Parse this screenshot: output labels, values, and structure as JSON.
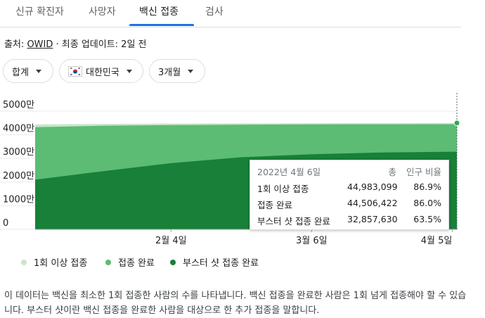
{
  "tabs": [
    {
      "label": "신규 확진자"
    },
    {
      "label": "사망자"
    },
    {
      "label": "백신 접종"
    },
    {
      "label": "검사"
    }
  ],
  "source": {
    "prefix": "출처: ",
    "link": "OWID",
    "suffix": " · 최종 업데이트: 2일 전"
  },
  "filters": [
    {
      "label": "합계"
    },
    {
      "label": "대한민국"
    },
    {
      "label": "3개월"
    }
  ],
  "chart_data": {
    "type": "area",
    "colors": {
      "one_dose": "#c8e6c9",
      "full": "#5cbc73",
      "booster": "#188038"
    },
    "y_ticks": [
      "0",
      "1000만",
      "2000만",
      "3000만",
      "4000만",
      "5000만"
    ],
    "ylim": [
      0,
      50000000
    ],
    "x_ticks": [
      "2월 4일",
      "3월 6일",
      "4월 5일"
    ],
    "x": [
      "2022-01-06",
      "2022-01-20",
      "2022-02-04",
      "2022-02-19",
      "2022-03-06",
      "2022-03-21",
      "2022-04-06"
    ],
    "series": [
      {
        "name": "1회 이상 접종",
        "values": [
          44400000,
          44600000,
          44750000,
          44850000,
          44900000,
          44950000,
          44983099
        ]
      },
      {
        "name": "접종 완료",
        "values": [
          43200000,
          43800000,
          44100000,
          44300000,
          44400000,
          44460000,
          44506422
        ]
      },
      {
        "name": "부스터 샷 접종 완료",
        "values": [
          21000000,
          24500000,
          28000000,
          30500000,
          31800000,
          32500000,
          32857630
        ]
      }
    ]
  },
  "tooltip": {
    "date": "2022년 4월 6일",
    "col_total": "총",
    "col_pop": "인구 비율",
    "rows": [
      {
        "label": "1회 이상 접종",
        "total": "44,983,099",
        "pct": "86.9%"
      },
      {
        "label": "접종 완료",
        "total": "44,506,422",
        "pct": "86.0%"
      },
      {
        "label": "부스터 샷 접종 완료",
        "total": "32,857,630",
        "pct": "63.5%"
      }
    ]
  },
  "description": "이 데이터는 백신을 최소한 1회 접종한 사람의 수를 나타냅니다. 백신 접종을 완료한 사람은 1회 넘게 접종해야 할 수 있습니다. 부스터 샷이란 백신 접종을 완료한 사람을 대상으로 한 추가 접종을 말합니다."
}
